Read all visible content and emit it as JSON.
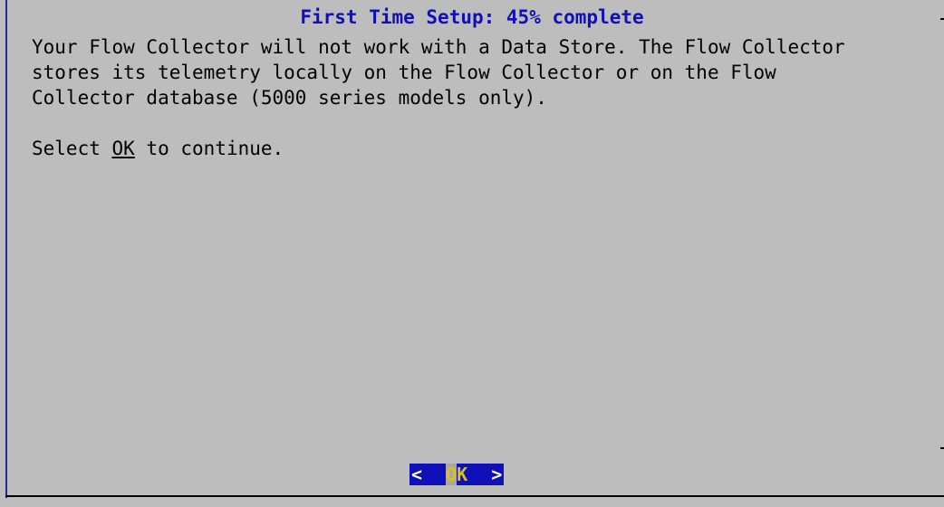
{
  "dialog": {
    "title": "First Time Setup: 45% complete",
    "progress_percent": 45,
    "body_lines": [
      "Your Flow Collector will not work with a Data Store. The Flow Collector",
      "stores its telemetry locally on the Flow Collector or on the Flow",
      "Collector database (5000 series models only)."
    ],
    "prompt_prefix": "Select ",
    "prompt_ok": "OK",
    "prompt_suffix": " to continue."
  },
  "buttons": {
    "ok": {
      "left_bracket": "<",
      "cursor_char": "O",
      "label_rest": "K",
      "right_bracket": ">"
    }
  },
  "colors": {
    "background": "#bdbdbd",
    "title": "#1010b8",
    "button_bg": "#1010b8",
    "hotkey": "#d8c020",
    "border": "#1c2c8f"
  }
}
